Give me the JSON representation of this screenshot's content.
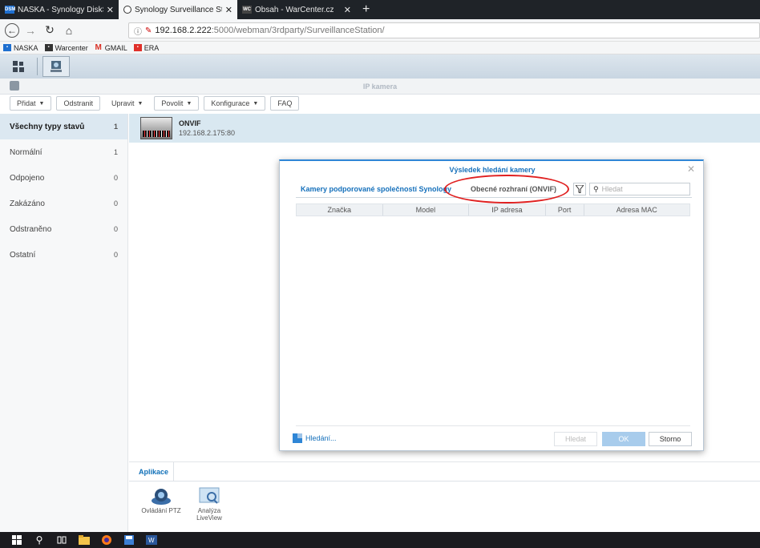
{
  "browser": {
    "tabs": [
      {
        "label": "NASKA - Synology DiskStation",
        "favicon": "DSM"
      },
      {
        "label": "Synology Surveillance Station -",
        "favicon": "eye"
      },
      {
        "label": "Obsah - WarCenter.cz",
        "favicon": "WC"
      }
    ],
    "url_host": "192.168.2.222",
    "url_path": ":5000/webman/3rdparty/SurveillanceStation/",
    "bookmarks": [
      {
        "label": "NASKA",
        "color": "#1e6fd0"
      },
      {
        "label": "Warcenter",
        "color": "#333333"
      },
      {
        "label": "GMAIL",
        "color": "#d93025"
      },
      {
        "label": "ERA",
        "color": "#e0302a"
      }
    ]
  },
  "app": {
    "title": "IP kamera",
    "toolbar": {
      "add": "Přidat",
      "remove": "Odstranit",
      "edit": "Upravit",
      "enable": "Povolit",
      "config": "Konfigurace",
      "faq": "FAQ"
    },
    "sidebar": [
      {
        "label": "Všechny typy stavů",
        "count": "1"
      },
      {
        "label": "Normální",
        "count": "1"
      },
      {
        "label": "Odpojeno",
        "count": "0"
      },
      {
        "label": "Zakázáno",
        "count": "0"
      },
      {
        "label": "Odstraněno",
        "count": "0"
      },
      {
        "label": "Ostatní",
        "count": "0"
      }
    ],
    "camera": {
      "name": "ONVIF",
      "ip": "192.168.2.175:80"
    },
    "bottom": {
      "tab": "Aplikace",
      "apps": [
        {
          "label": "Ovládání PTZ"
        },
        {
          "label": "Analýza LiveView"
        }
      ]
    }
  },
  "dialog": {
    "title": "Výsledek hledání kamery",
    "tab_supported": "Kamery podporované společností Synology",
    "tab_onvif": "Obecné rozhraní (ONVIF)",
    "search_placeholder": "Hledat",
    "columns": [
      "Značka",
      "Model",
      "IP adresa",
      "Port",
      "Adresa MAC"
    ],
    "loading": "Hledání...",
    "btn_search": "Hledat",
    "btn_ok": "OK",
    "btn_cancel": "Storno"
  },
  "colors": {
    "accent": "#1570bb",
    "highlight": "#e02020"
  }
}
